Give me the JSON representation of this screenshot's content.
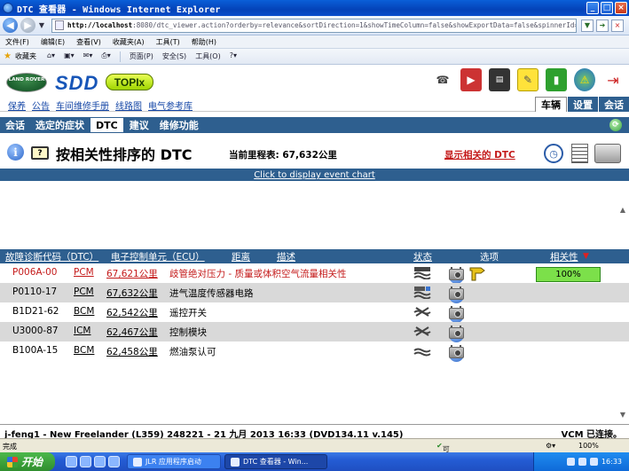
{
  "window": {
    "title": "DTC 查看器 - Windows Internet Explorer"
  },
  "address": {
    "url_host": "http://localhost",
    "url_path": ":8080/dtc_viewer.action?orderby=relevance&sortDirection=1&showTimeColumn=false&showExportData=false&spinnerId=6709"
  },
  "menu": [
    "文件(F)",
    "编辑(E)",
    "查看(V)",
    "收藏夹(A)",
    "工具(T)",
    "帮助(H)"
  ],
  "favbar": {
    "favorites": "收藏夹",
    "page": "页面(P)",
    "safety": "安全(S)",
    "tools": "工具(O)"
  },
  "brand": {
    "land_rover": "LAND ROVER",
    "sdd": "SDD",
    "topix": "TOPIx"
  },
  "toplinks": [
    "保养",
    "公告",
    "车间维修手册",
    "线路图",
    "电气参考库"
  ],
  "righttabs": [
    "车辆",
    "设置",
    "会话"
  ],
  "sectabs": [
    "会话",
    "选定的症状",
    "DTC",
    "建议",
    "维修功能"
  ],
  "dtc_header": {
    "title": "按相关性排序的 DTC",
    "mileage": "当前里程表: 67,632公里",
    "show_related": "显示相关的 DTC"
  },
  "event_chart_link": "Click to display event chart",
  "table": {
    "headers": {
      "code": "故障诊断代码（DTC）",
      "ecu": "电子控制单元（ECU）",
      "distance": "距离",
      "description": "描述",
      "status": "状态",
      "options": "选项",
      "relevance": "相关性"
    },
    "rows": [
      {
        "code": "P006A-00",
        "ecu": "PCM",
        "distance": "67,621公里",
        "description": "歧管绝对压力 - 质量或体积空气流量相关性",
        "relevance": "100%"
      },
      {
        "code": "P0110-17",
        "ecu": "PCM",
        "distance": "67,632公里",
        "description": "进气温度传感器电路"
      },
      {
        "code": "B1D21-62",
        "ecu": "BCM",
        "distance": "62,542公里",
        "description": "遥控开关"
      },
      {
        "code": "U3000-87",
        "ecu": "ICM",
        "distance": "62,467公里",
        "description": "控制模块"
      },
      {
        "code": "B100A-15",
        "ecu": "BCM",
        "distance": "62,458公里",
        "description": "燃油泵认可"
      }
    ]
  },
  "footer": {
    "session": "j-feng1 - New Freelander (L359) 248221 - 21 九月 2013 16:33 (DVD134.11 v.145)",
    "vcm": "VCM 已连接。"
  },
  "ie_status": {
    "done": "完成",
    "zone": "可信站点",
    "zoom": "100%"
  },
  "taskbar": {
    "start": "开始",
    "task1": "JLR 应用程序启动",
    "task2": "DTC 查看器 - Win...",
    "clock": "16:33"
  }
}
